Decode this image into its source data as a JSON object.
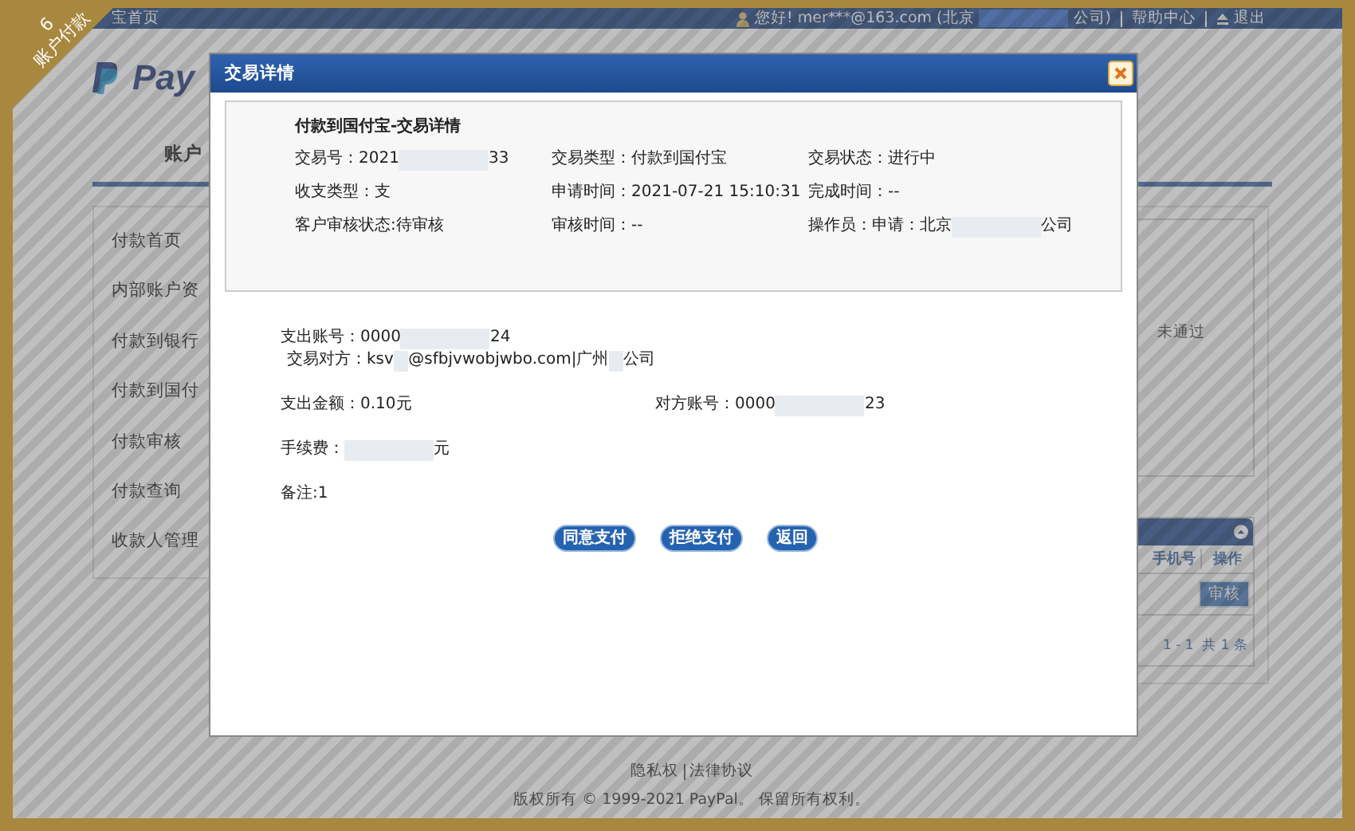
{
  "ribbon": {
    "number": "6",
    "label": "账户付款"
  },
  "top_bar": {
    "home_link": "宝首页",
    "greeting": [
      {
        "kind": "text",
        "text": "您好! mer***@163.com (北京"
      },
      {
        "kind": "redacted"
      },
      {
        "kind": "text",
        "text": "公司)"
      }
    ],
    "links": [
      "帮助中心",
      "退出"
    ]
  },
  "logo": "Pay",
  "nav": [
    "账户"
  ],
  "sidebar": {
    "items": [
      "付款首页",
      "内部账户资",
      "付款到银行",
      "付款到国付",
      "付款审核",
      "付款查询",
      "收款人管理"
    ]
  },
  "background_panel": {
    "status_text": "未通过",
    "table": {
      "columns": [
        "手机号",
        "操作"
      ],
      "action_button": "审核",
      "pager": "1 - 1  共 1 条"
    }
  },
  "dialog": {
    "title": "交易详情",
    "summary": {
      "title": "付款到国付宝-交易详情",
      "fields": [
        {
          "label": "交易号：",
          "segments": [
            {
              "kind": "text",
              "text": "2021"
            },
            {
              "kind": "redacted"
            },
            {
              "kind": "text",
              "text": "33"
            }
          ]
        },
        {
          "label": "交易类型：",
          "segments": [
            {
              "kind": "text",
              "text": "付款到国付宝"
            }
          ]
        },
        {
          "label": "交易状态：",
          "segments": [
            {
              "kind": "text",
              "text": "进行中"
            }
          ]
        },
        {
          "label": "收支类型：",
          "segments": [
            {
              "kind": "text",
              "text": "支"
            }
          ]
        },
        {
          "label": "申请时间：",
          "segments": [
            {
              "kind": "text",
              "text": "2021-07-21 15:10:31"
            }
          ]
        },
        {
          "label": "完成时间：",
          "segments": [
            {
              "kind": "text",
              "text": "--"
            }
          ]
        },
        {
          "label": "客户审核状态:",
          "segments": [
            {
              "kind": "text",
              "text": "待审核"
            }
          ]
        },
        {
          "label": "审核时间：",
          "segments": [
            {
              "kind": "text",
              "text": "--"
            }
          ]
        },
        {
          "label": "操作员：",
          "segments": [
            {
              "kind": "text",
              "text": "申请：北京"
            },
            {
              "kind": "redacted"
            },
            {
              "kind": "text",
              "text": "公司"
            }
          ]
        }
      ]
    },
    "details": [
      {
        "lines": [
          {
            "fields": [
              {
                "label": "支出账号：",
                "segments": [
                  {
                    "kind": "text",
                    "text": "0000"
                  },
                  {
                    "kind": "redacted"
                  },
                  {
                    "kind": "text",
                    "text": "24"
                  }
                ]
              }
            ]
          },
          {
            "fields": [
              {
                "label": "交易对方：",
                "segments": [
                  {
                    "kind": "text",
                    "text": "ksv"
                  },
                  {
                    "kind": "redacted"
                  },
                  {
                    "kind": "text",
                    "text": "@sfbjvwobjwbo.com|广州"
                  },
                  {
                    "kind": "redacted"
                  },
                  {
                    "kind": "text",
                    "text": "公司"
                  }
                ]
              }
            ]
          }
        ]
      },
      {
        "lines": [
          {
            "fields": [
              {
                "label": "支出金额：",
                "segments": [
                  {
                    "kind": "text",
                    "text": "0.10元"
                  }
                ]
              },
              {
                "label": "对方账号：",
                "segments": [
                  {
                    "kind": "text",
                    "text": "0000"
                  },
                  {
                    "kind": "redacted"
                  },
                  {
                    "kind": "text",
                    "text": "23"
                  }
                ]
              }
            ]
          }
        ]
      },
      {
        "lines": [
          {
            "fields": [
              {
                "label": "手续费：",
                "segments": [
                  {
                    "kind": "redacted"
                  },
                  {
                    "kind": "text",
                    "text": "元"
                  }
                ]
              }
            ]
          }
        ]
      },
      {
        "lines": [
          {
            "fields": [
              {
                "label": "备注:",
                "segments": [
                  {
                    "kind": "text",
                    "text": "1"
                  }
                ]
              }
            ]
          }
        ]
      }
    ],
    "buttons": [
      "同意支付",
      "拒绝支付",
      "返回"
    ]
  },
  "footer": {
    "links": [
      "隐私权",
      "法律协议"
    ],
    "copyright": "版权所有 © 1999-2021 PayPal。 保留所有权利。"
  }
}
